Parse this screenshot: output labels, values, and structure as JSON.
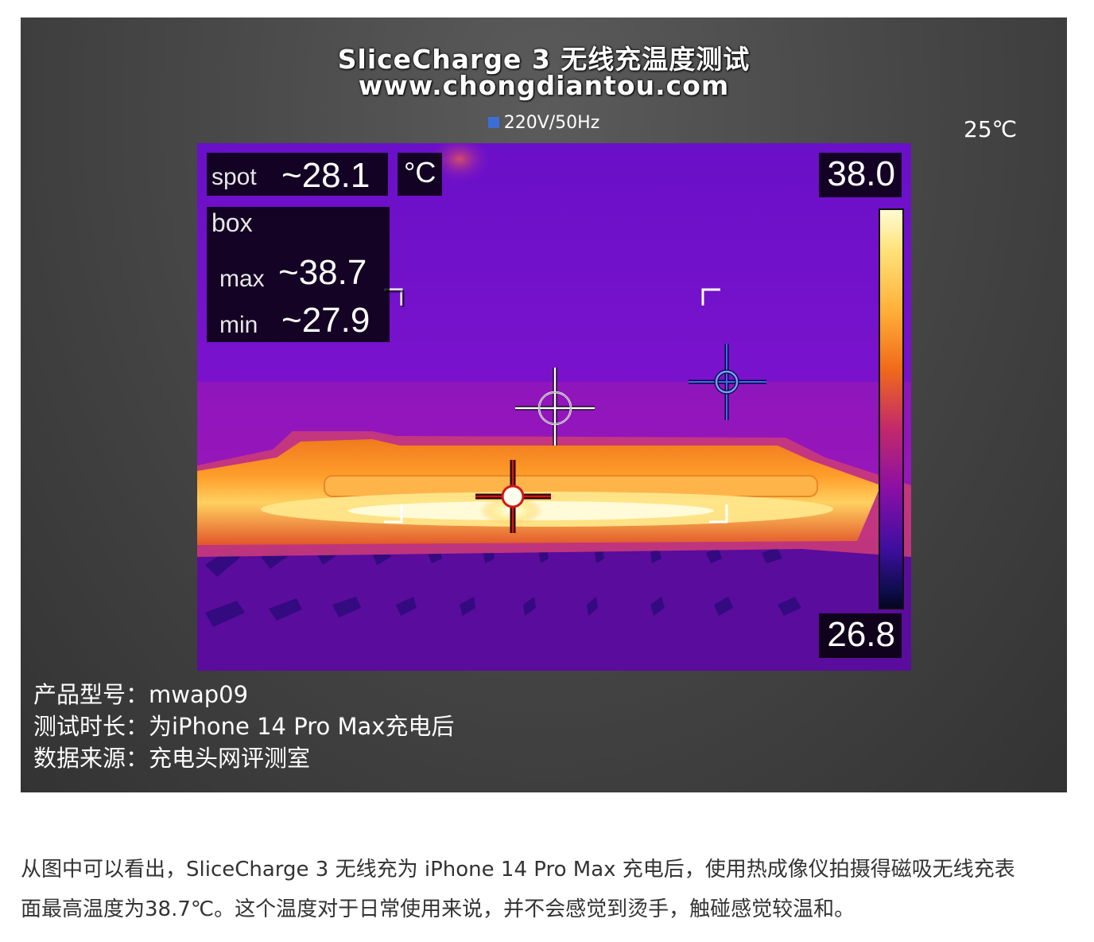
{
  "figure": {
    "title_line1": "SliceCharge 3 无线充温度测试",
    "title_line2": "www.chongdiantou.com",
    "voltage": "220V/50Hz",
    "ambient_temp": "25℃",
    "thermal": {
      "spot_label": "spot",
      "spot_value": "~28.1",
      "unit": "°C",
      "box_label": "box",
      "max_label": "max",
      "max_value": "~38.7",
      "min_label": "min",
      "min_value": "~27.9",
      "scale_max": "38.0",
      "scale_min": "26.8"
    },
    "captions": [
      "产品型号：mwap09",
      "测试时长：为iPhone 14 Pro Max充电后",
      "数据来源：充电头网评测室"
    ]
  },
  "paragraph": {
    "line1": "从图中可以看出，SliceCharge 3 无线充为 iPhone 14 Pro Max 充电后，使用热成像仪拍摄得磁吸无线充表",
    "line2": "面最高温度为38.7℃。这个温度对于日常使用来说，并不会感觉到烫手，触碰感觉较温和。"
  },
  "colors": {
    "panel_bg": "#3d3d3d",
    "voltage_marker": "#3b6fd6",
    "body_text": "#333333"
  }
}
